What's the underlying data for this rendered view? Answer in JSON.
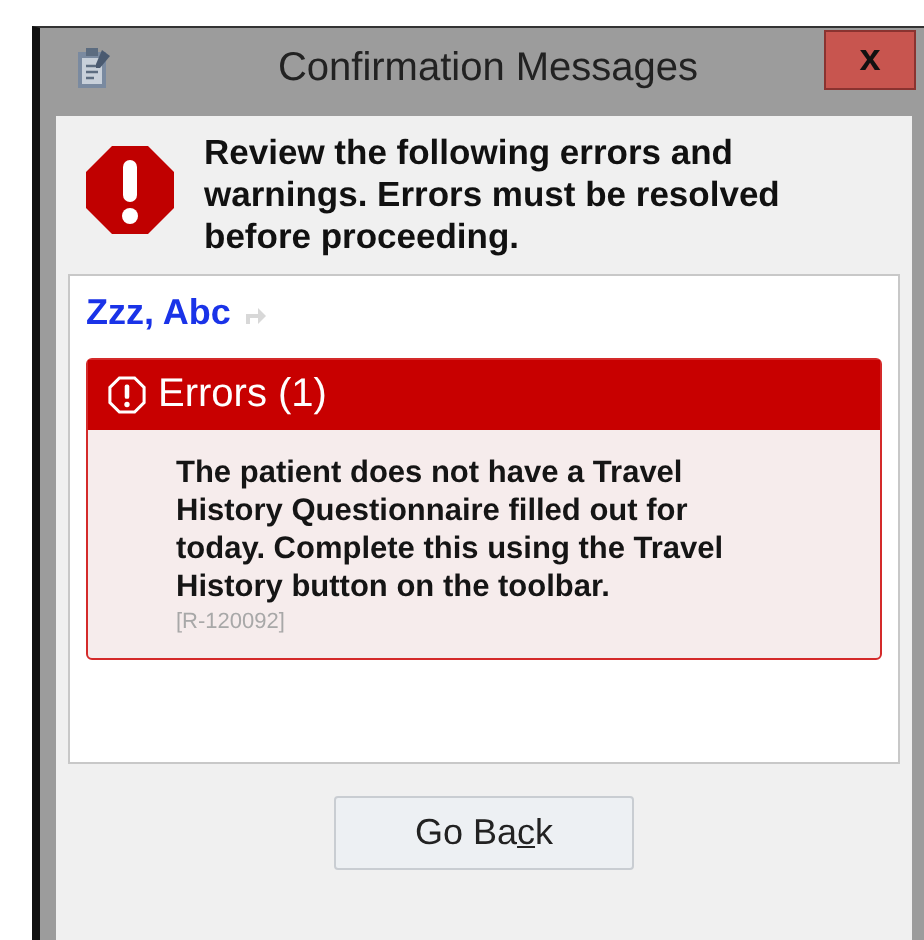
{
  "window": {
    "title": "Confirmation Messages",
    "close_label": "x"
  },
  "header": {
    "message": "Review the following errors and warnings. Errors must be resolved before proceeding."
  },
  "patient": {
    "name": "Zzz, Abc"
  },
  "errors": {
    "title": "Errors (1)",
    "items": [
      {
        "text": "The patient does not have a Travel History Questionnaire filled out for today. Complete this using the Travel History button on the toolbar.",
        "code": "[R-120092]"
      }
    ]
  },
  "buttons": [
    {
      "label_parts": [
        {
          "text": "Go Ba",
          "underlined": false
        },
        {
          "text": "c",
          "underlined": true
        },
        {
          "text": "k",
          "underlined": false
        }
      ]
    }
  ]
}
